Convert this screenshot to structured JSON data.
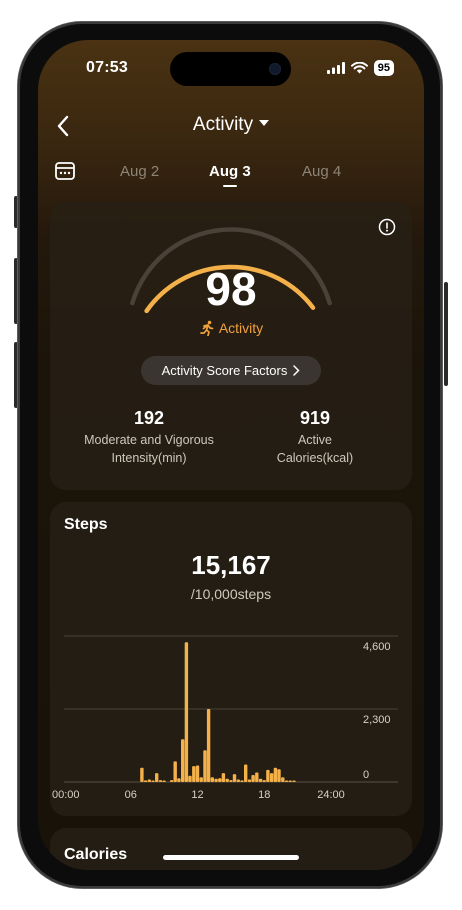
{
  "status_bar": {
    "time": "07:53",
    "battery": "95"
  },
  "nav": {
    "title": "Activity"
  },
  "dates": [
    {
      "label": "Aug 2",
      "active": false
    },
    {
      "label": "Aug 3",
      "active": true
    },
    {
      "label": "Aug 4",
      "active": false
    }
  ],
  "score_card": {
    "score": "98",
    "label": "Activity",
    "score_fraction": 0.98,
    "factors_button": "Activity Score Factors",
    "metrics": [
      {
        "value": "192",
        "label_line1": "Moderate and Vigorous",
        "label_line2": "Intensity(min)"
      },
      {
        "value": "919",
        "label_line1": "Active",
        "label_line2": "Calories(kcal)"
      }
    ]
  },
  "steps_card": {
    "title": "Steps",
    "value": "15,167",
    "goal": "/10,000steps"
  },
  "next_card_title": "Calories",
  "colors": {
    "accent": "#f4b14a",
    "gauge_track": "#4a4238",
    "score_label": "#f2a23c"
  },
  "chart_data": {
    "type": "bar",
    "title": "Steps",
    "x_tick_labels": [
      "00:00",
      "06",
      "12",
      "18",
      "24:00"
    ],
    "y_tick_labels": [
      "4,600",
      "2,300",
      "0"
    ],
    "ylim": [
      0,
      4600
    ],
    "grid": true,
    "interval_minutes": 20,
    "bars": [
      {
        "t": 7.0,
        "v": 450
      },
      {
        "t": 7.33,
        "v": 50
      },
      {
        "t": 7.67,
        "v": 80
      },
      {
        "t": 8.0,
        "v": 30
      },
      {
        "t": 8.33,
        "v": 280
      },
      {
        "t": 8.67,
        "v": 60
      },
      {
        "t": 9.0,
        "v": 20
      },
      {
        "t": 9.67,
        "v": 60
      },
      {
        "t": 10.0,
        "v": 650
      },
      {
        "t": 10.33,
        "v": 120
      },
      {
        "t": 10.67,
        "v": 1350
      },
      {
        "t": 11.0,
        "v": 4400
      },
      {
        "t": 11.33,
        "v": 200
      },
      {
        "t": 11.67,
        "v": 500
      },
      {
        "t": 12.0,
        "v": 520
      },
      {
        "t": 12.33,
        "v": 150
      },
      {
        "t": 12.67,
        "v": 1000
      },
      {
        "t": 13.0,
        "v": 2300
      },
      {
        "t": 13.33,
        "v": 150
      },
      {
        "t": 13.67,
        "v": 100
      },
      {
        "t": 14.0,
        "v": 120
      },
      {
        "t": 14.33,
        "v": 280
      },
      {
        "t": 14.67,
        "v": 100
      },
      {
        "t": 15.0,
        "v": 60
      },
      {
        "t": 15.33,
        "v": 250
      },
      {
        "t": 15.67,
        "v": 80
      },
      {
        "t": 16.0,
        "v": 50
      },
      {
        "t": 16.33,
        "v": 550
      },
      {
        "t": 16.67,
        "v": 80
      },
      {
        "t": 17.0,
        "v": 220
      },
      {
        "t": 17.33,
        "v": 300
      },
      {
        "t": 17.67,
        "v": 100
      },
      {
        "t": 18.0,
        "v": 60
      },
      {
        "t": 18.33,
        "v": 380
      },
      {
        "t": 18.67,
        "v": 280
      },
      {
        "t": 19.0,
        "v": 450
      },
      {
        "t": 19.33,
        "v": 400
      },
      {
        "t": 19.67,
        "v": 150
      },
      {
        "t": 20.0,
        "v": 40
      },
      {
        "t": 20.33,
        "v": 20
      },
      {
        "t": 20.67,
        "v": 30
      }
    ]
  }
}
